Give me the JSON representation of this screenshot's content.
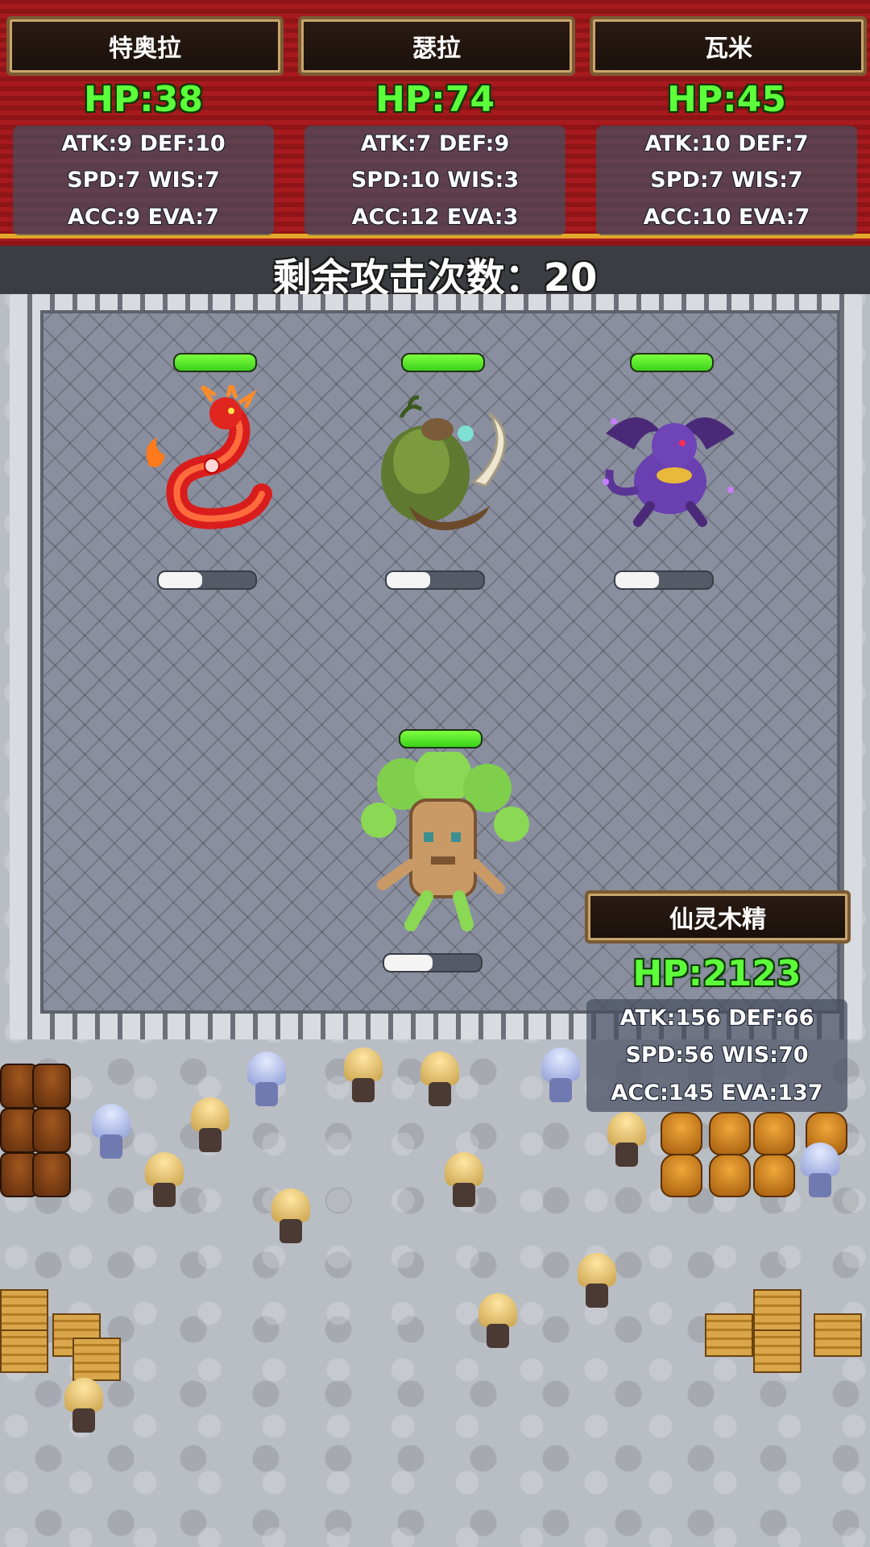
{
  "heroes": [
    {
      "name": "特奥拉",
      "hp": "HP:38",
      "line1": "ATK:9 DEF:10",
      "line2": "SPD:7 WIS:7",
      "line3": "ACC:9 EVA:7"
    },
    {
      "name": "瑟拉",
      "hp": "HP:74",
      "line1": "ATK:7 DEF:9",
      "line2": "SPD:10 WIS:3",
      "line3": "ACC:12 EVA:3"
    },
    {
      "name": "瓦米",
      "hp": "HP:45",
      "line1": "ATK:10 DEF:7",
      "line2": "SPD:7 WIS:7",
      "line3": "ACC:10 EVA:7"
    }
  ],
  "remaining_attacks": "剩余攻击次数：20",
  "monsters": [
    {
      "icon": "red-fire-serpent-icon",
      "hp_fraction": 1.0,
      "turn_fraction": 0.45
    },
    {
      "icon": "forest-treant-beast-icon",
      "hp_fraction": 1.0,
      "turn_fraction": 0.45
    },
    {
      "icon": "purple-dragon-icon",
      "hp_fraction": 1.0,
      "turn_fraction": 0.45
    }
  ],
  "boss": {
    "name": "仙灵木精",
    "hp": "HP:2123",
    "line1": "ATK:156 DEF:66",
    "line2": "SPD:56 WIS:70",
    "line3": "ACC:145 EVA:137",
    "icon": "tree-spirit-icon",
    "hp_fraction": 1.0,
    "turn_fraction": 0.5
  },
  "colors": {
    "hp_green": "#5cff3a",
    "carpet_red": "#a71a1e",
    "gold": "#e2a72b"
  }
}
